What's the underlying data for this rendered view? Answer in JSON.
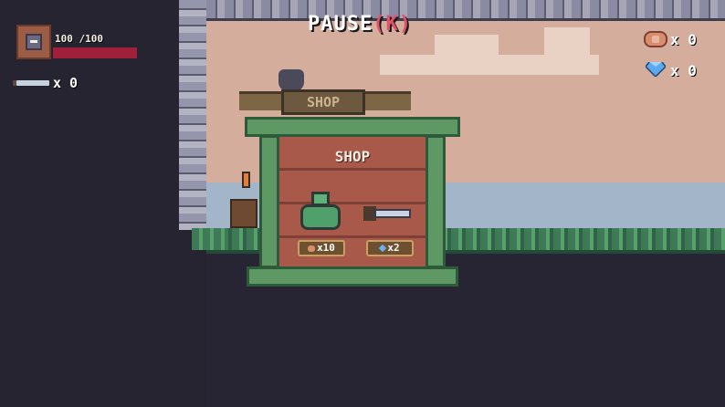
{
  "hud": {
    "health_text": "100 /100",
    "health_value": 100,
    "health_max": 100,
    "sword_count": "x 0",
    "pause_label": "PAUSE",
    "pause_key": "(K)",
    "coin_count": "x 0",
    "gem_count": "x 0"
  },
  "shop": {
    "sign_text": "SHOP",
    "title": "SHOP",
    "items": [
      {
        "name": "potion",
        "price": "x10",
        "currency": "coin-icon"
      },
      {
        "name": "sword",
        "price": "x2",
        "currency": "gem-icon"
      }
    ]
  },
  "colors": {
    "health_bar": "#a01f3b",
    "pause_key": "#e0536b",
    "background": "#262431"
  }
}
